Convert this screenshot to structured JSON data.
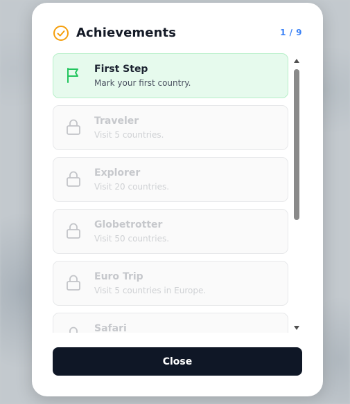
{
  "modal": {
    "title": "Achievements",
    "counter": "1 / 9",
    "accent_color": "#f59e0b",
    "close_label": "Close"
  },
  "achievements": [
    {
      "name": "First Step",
      "description": "Mark your first country.",
      "status": "unlocked",
      "icon": "flag-icon"
    },
    {
      "name": "Traveler",
      "description": "Visit 5 countries.",
      "status": "locked",
      "icon": "lock-icon"
    },
    {
      "name": "Explorer",
      "description": "Visit 20 countries.",
      "status": "locked",
      "icon": "lock-icon"
    },
    {
      "name": "Globetrotter",
      "description": "Visit 50 countries.",
      "status": "locked",
      "icon": "lock-icon"
    },
    {
      "name": "Euro Trip",
      "description": "Visit 5 countries in Europe.",
      "status": "locked",
      "icon": "lock-icon"
    },
    {
      "name": "Safari",
      "description": "",
      "status": "locked",
      "icon": "lock-icon"
    }
  ]
}
